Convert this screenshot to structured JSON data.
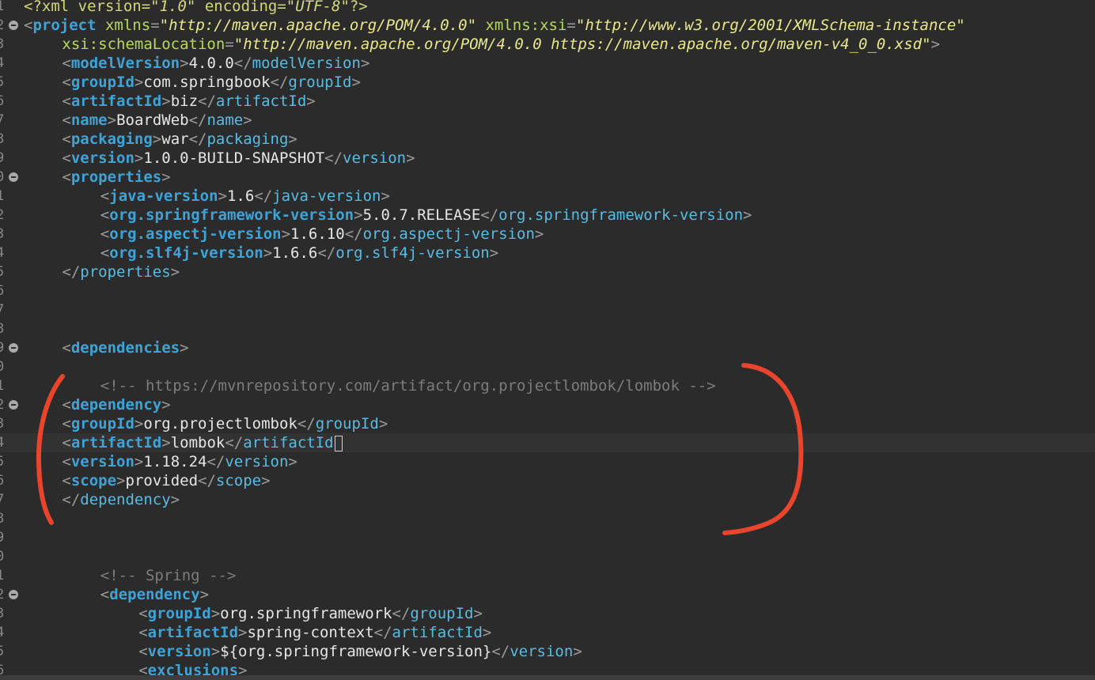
{
  "editor": {
    "lines": [
      {
        "n": "1",
        "fold": false,
        "indent": 0,
        "kind": "xmldecl",
        "name": "?xml",
        "attrs": [
          [
            "version",
            "1.0"
          ],
          [
            "encoding",
            "UTF-8"
          ]
        ]
      },
      {
        "n": "2",
        "fold": true,
        "indent": 0,
        "kind": "open",
        "name": "project",
        "attrs": [
          [
            "xmlns",
            "http://maven.apache.org/POM/4.0.0"
          ],
          [
            "xmlns:xsi",
            "http://www.w3.org/2001/XMLSchema-instance"
          ]
        ]
      },
      {
        "n": "3",
        "fold": false,
        "indent": 4,
        "kind": "attrcont",
        "attrs": [
          [
            "xsi:schemaLocation",
            "http://maven.apache.org/POM/4.0.0 https://maven.apache.org/maven-v4_0_0.xsd"
          ]
        ],
        "close": ">"
      },
      {
        "n": "4",
        "fold": false,
        "indent": 4,
        "kind": "element",
        "name": "modelVersion",
        "text": "4.0.0"
      },
      {
        "n": "5",
        "fold": false,
        "indent": 4,
        "kind": "element",
        "name": "groupId",
        "text": "com.springbook"
      },
      {
        "n": "6",
        "fold": false,
        "indent": 4,
        "kind": "element",
        "name": "artifactId",
        "text": "biz"
      },
      {
        "n": "7",
        "fold": false,
        "indent": 4,
        "kind": "element",
        "name": "name",
        "text": "BoardWeb"
      },
      {
        "n": "8",
        "fold": false,
        "indent": 4,
        "kind": "element",
        "name": "packaging",
        "text": "war"
      },
      {
        "n": "9",
        "fold": false,
        "indent": 4,
        "kind": "element",
        "name": "version",
        "text": "1.0.0-BUILD-SNAPSHOT"
      },
      {
        "n": "0",
        "fold": true,
        "indent": 4,
        "kind": "open",
        "name": "properties"
      },
      {
        "n": "1",
        "fold": false,
        "indent": 8,
        "kind": "element",
        "name": "java-version",
        "text": "1.6"
      },
      {
        "n": "2",
        "fold": false,
        "indent": 8,
        "kind": "element",
        "name": "org.springframework-version",
        "text": "5.0.7.RELEASE"
      },
      {
        "n": "3",
        "fold": false,
        "indent": 8,
        "kind": "element",
        "name": "org.aspectj-version",
        "text": "1.6.10"
      },
      {
        "n": "4",
        "fold": false,
        "indent": 8,
        "kind": "element",
        "name": "org.slf4j-version",
        "text": "1.6.6"
      },
      {
        "n": "5",
        "fold": false,
        "indent": 4,
        "kind": "close",
        "name": "properties"
      },
      {
        "n": "6",
        "fold": false,
        "indent": 0,
        "kind": "blank"
      },
      {
        "n": "7",
        "fold": false,
        "indent": 0,
        "kind": "blank"
      },
      {
        "n": "8",
        "fold": false,
        "indent": 0,
        "kind": "blank"
      },
      {
        "n": "9",
        "fold": true,
        "indent": 4,
        "kind": "open",
        "name": "dependencies"
      },
      {
        "n": "0",
        "fold": false,
        "indent": 0,
        "kind": "blank"
      },
      {
        "n": "1",
        "fold": false,
        "indent": 8,
        "kind": "comment",
        "text": "<!-- https://mvnrepository.com/artifact/org.projectlombok/lombok -->"
      },
      {
        "n": "2",
        "fold": true,
        "indent": 4,
        "kind": "open",
        "name": "dependency"
      },
      {
        "n": "3",
        "fold": false,
        "indent": 4,
        "kind": "element",
        "name": "groupId",
        "text": "org.projectlombok"
      },
      {
        "n": "4",
        "fold": false,
        "indent": 4,
        "kind": "element",
        "name": "artifactId",
        "text": "lombok",
        "current": true,
        "caret": true
      },
      {
        "n": "5",
        "fold": false,
        "indent": 4,
        "kind": "element",
        "name": "version",
        "text": "1.18.24"
      },
      {
        "n": "6",
        "fold": false,
        "indent": 4,
        "kind": "element",
        "name": "scope",
        "text": "provided"
      },
      {
        "n": "7",
        "fold": false,
        "indent": 4,
        "kind": "close",
        "name": "dependency"
      },
      {
        "n": "8",
        "fold": false,
        "indent": 0,
        "kind": "blank"
      },
      {
        "n": "9",
        "fold": false,
        "indent": 0,
        "kind": "blank"
      },
      {
        "n": "0",
        "fold": false,
        "indent": 0,
        "kind": "blank"
      },
      {
        "n": "1",
        "fold": false,
        "indent": 8,
        "kind": "comment",
        "text": "<!-- Spring -->"
      },
      {
        "n": "2",
        "fold": true,
        "indent": 8,
        "kind": "open",
        "name": "dependency"
      },
      {
        "n": "3",
        "fold": false,
        "indent": 12,
        "kind": "element",
        "name": "groupId",
        "text": "org.springframework"
      },
      {
        "n": "4",
        "fold": false,
        "indent": 12,
        "kind": "element",
        "name": "artifactId",
        "text": "spring-context"
      },
      {
        "n": "5",
        "fold": false,
        "indent": 12,
        "kind": "element",
        "name": "version",
        "text": "${org.springframework-version}"
      },
      {
        "n": "6",
        "fold": false,
        "indent": 12,
        "kind": "open",
        "name": "exclusions"
      }
    ]
  },
  "annotation": {
    "color": "#e8452c",
    "shape": "red hand-drawn brackets around the lombok dependency block"
  },
  "colors": {
    "background": "#2b2b2b",
    "tag": "#3fa3d6",
    "attribute": "#b9d760",
    "attribute_value": "#e9e98c",
    "text": "#e6e6e6",
    "comment": "#7c7c7c"
  }
}
